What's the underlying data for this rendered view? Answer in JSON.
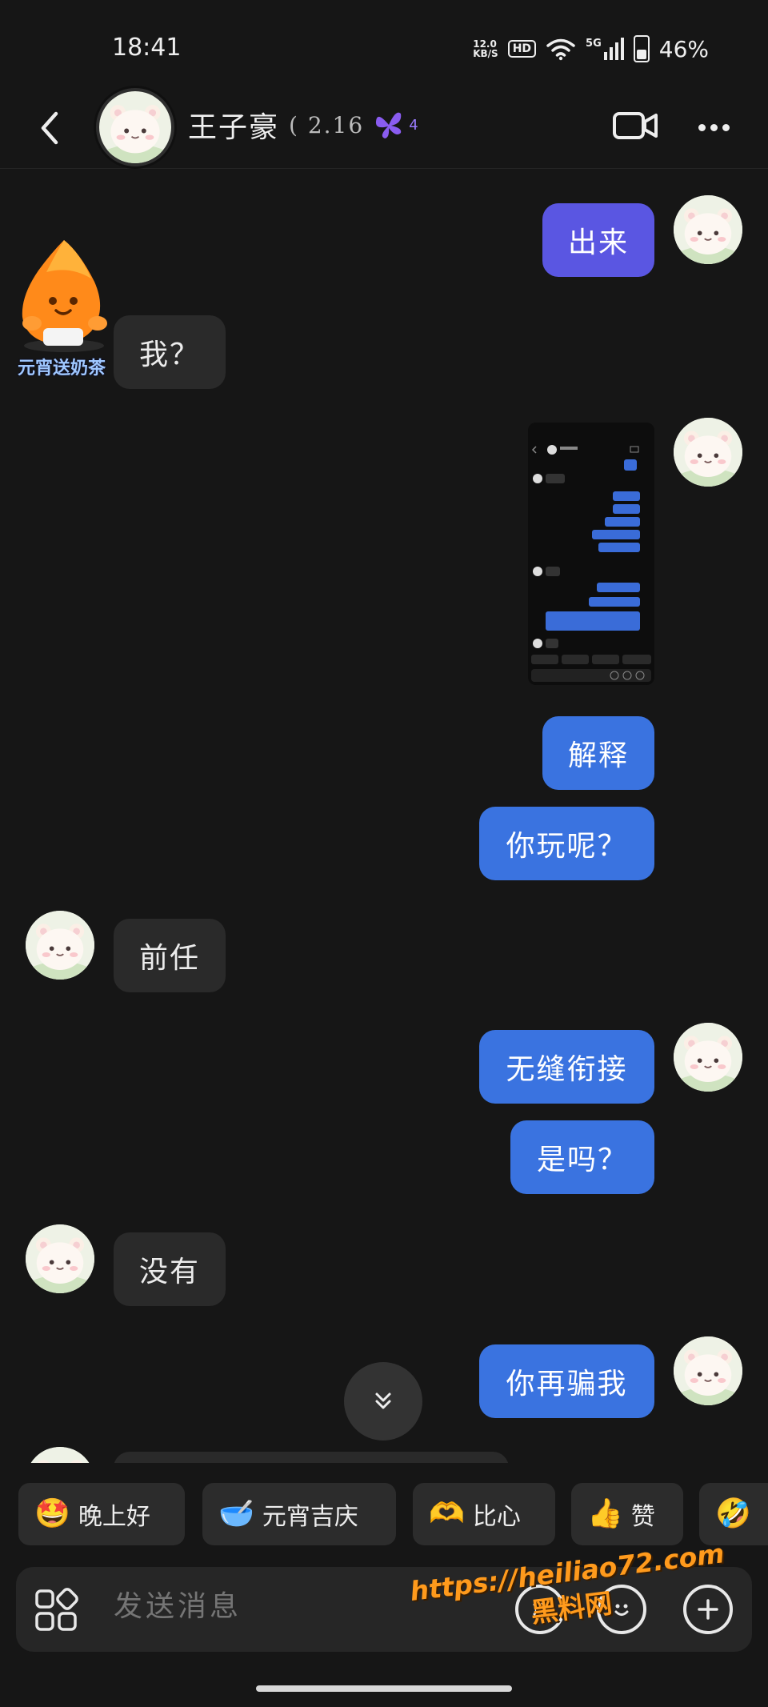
{
  "status": {
    "time": "18:41",
    "net_value": "12.0",
    "net_unit": "KB/S",
    "hd": "HD",
    "signal": "5G",
    "battery": "46%"
  },
  "header": {
    "contact_name": "王子豪",
    "subtitle": "( 2.16",
    "level": "4"
  },
  "messages": [
    {
      "from": "me",
      "text": "出来"
    },
    {
      "from": "them",
      "text": "我？",
      "sticker_caption": "元宵送奶茶"
    },
    {
      "from": "me",
      "type": "image"
    },
    {
      "from": "me",
      "text": "解释"
    },
    {
      "from": "me",
      "text": "你玩呢？"
    },
    {
      "from": "them",
      "text": "前任"
    },
    {
      "from": "me",
      "text": "无缝衔接"
    },
    {
      "from": "me",
      "text": "是吗？"
    },
    {
      "from": "them",
      "text": "没有"
    },
    {
      "from": "me",
      "text": "你再骗我"
    }
  ],
  "quick_replies": [
    {
      "icon": "star-face-icon",
      "emoji": "🤩",
      "label": "晚上好"
    },
    {
      "icon": "bowl-icon",
      "emoji": "🥣",
      "label": "元宵吉庆"
    },
    {
      "icon": "heart-hands-icon",
      "emoji": "🫶",
      "label": "比心"
    },
    {
      "icon": "thumbs-up-icon",
      "emoji": "👍",
      "label": "赞"
    },
    {
      "icon": "laughing-icon",
      "emoji": "🤣",
      "label": ""
    }
  ],
  "input": {
    "placeholder": "发送消息"
  },
  "watermark": {
    "url": "https://heiliao72.com",
    "text": "黑料网"
  },
  "colors": {
    "background": "#161616",
    "my_bubble": "#3a73e0",
    "my_bubble_alt": "#5a56e2",
    "their_bubble": "#2a2a2a",
    "accent_level": "#9a7bff",
    "watermark": "#ff9a1c"
  }
}
